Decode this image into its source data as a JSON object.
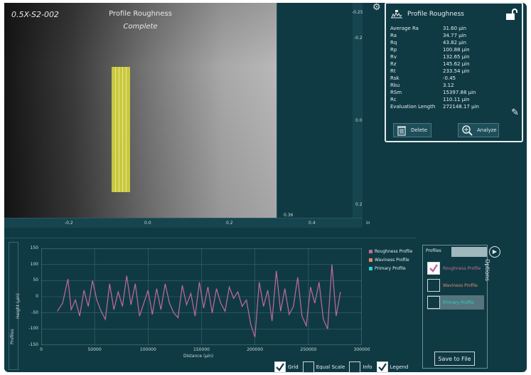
{
  "viewport": {
    "image_id": "0.5X-S2-002",
    "title": "Profile Roughness",
    "status": "Complete",
    "scale_right_ticks": [
      "-0.25",
      "-0.2",
      "0.0",
      "0.2"
    ],
    "scale_bottom_ticks": [
      "-0.2",
      "0.0",
      "0.2",
      "0.4"
    ],
    "scale_corner": "0.36",
    "scale_unit": "in"
  },
  "info_panel": {
    "title": "Profile Roughness",
    "metrics": [
      {
        "key": "Average Ra",
        "value": "31.60 µin"
      },
      {
        "key": "Ra",
        "value": "34.77 µin"
      },
      {
        "key": "Rq",
        "value": "43.82 µin"
      },
      {
        "key": "Rp",
        "value": "100.88 µin"
      },
      {
        "key": "Rv",
        "value": "132.65 µin"
      },
      {
        "key": "Rz",
        "value": "145.62 µin"
      },
      {
        "key": "Rt",
        "value": "233.54 µin"
      },
      {
        "key": "Rsk",
        "value": "-0.45"
      },
      {
        "key": "Rku",
        "value": "3.12"
      },
      {
        "key": "RSm",
        "value": "15397.88 µin"
      },
      {
        "key": "Rc",
        "value": "110.11 µin"
      },
      {
        "key": "Evaluation Length",
        "value": "272148.17 µin"
      }
    ],
    "delete_label": "Delete",
    "analyze_label": "Analyze"
  },
  "chart_data": {
    "type": "line",
    "xlabel": "Distance (µin)",
    "ylabel": "Height (µin)",
    "xlim": [
      0,
      300000
    ],
    "ylim": [
      -150,
      150
    ],
    "xticks": [
      "0",
      "50000",
      "100000",
      "150000",
      "200000",
      "250000",
      "300000"
    ],
    "yticks": [
      "150",
      "100",
      "50",
      "0",
      "-50",
      "-100",
      "-150"
    ],
    "grid": true,
    "legend": "right",
    "series": [
      {
        "name": "Roughness Profile",
        "color": "#c46aa0",
        "x": [
          15000,
          20000,
          25000,
          28000,
          32000,
          36000,
          40000,
          44000,
          48000,
          52000,
          56000,
          60000,
          64000,
          68000,
          72000,
          76000,
          80000,
          84000,
          88000,
          92000,
          96000,
          100000,
          104000,
          108000,
          112000,
          116000,
          120000,
          124000,
          128000,
          132000,
          136000,
          140000,
          144000,
          148000,
          152000,
          156000,
          160000,
          164000,
          168000,
          172000,
          176000,
          180000,
          184000,
          188000,
          192000,
          196000,
          200000,
          204000,
          208000,
          212000,
          216000,
          220000,
          224000,
          228000,
          232000,
          236000,
          240000,
          244000,
          248000,
          252000,
          256000,
          260000,
          264000,
          268000,
          272000,
          276000,
          280000
        ],
        "y": [
          -45,
          -20,
          55,
          -40,
          -10,
          -60,
          20,
          -30,
          50,
          -10,
          -45,
          -70,
          40,
          -40,
          15,
          -30,
          65,
          -25,
          40,
          -60,
          -20,
          20,
          -55,
          25,
          -40,
          40,
          -20,
          -50,
          -65,
          35,
          -25,
          10,
          -60,
          45,
          -35,
          30,
          -50,
          25,
          -20,
          -45,
          30,
          -5,
          15,
          -30,
          -10,
          -85,
          -125,
          45,
          -30,
          20,
          -75,
          80,
          -45,
          25,
          -55,
          -30,
          60,
          -60,
          -90,
          30,
          -20,
          45,
          -70,
          -100,
          100,
          -60,
          15
        ]
      },
      {
        "name": "Waviness Profile",
        "color": "#e58b6a",
        "x": [],
        "y": []
      },
      {
        "name": "Primary Profile",
        "color": "#28d4c8",
        "x": [],
        "y": []
      }
    ]
  },
  "options_panel": {
    "tab_label": "Profiles",
    "items": [
      {
        "label": "Roughness Profile",
        "checked": true,
        "color": "#c46aa0"
      },
      {
        "label": "Waviness Profile",
        "checked": false,
        "color": "#e58b6a"
      },
      {
        "label": "Primary Profile",
        "checked": false,
        "color": "#28d4c8"
      }
    ],
    "save_label": "Save to File",
    "options_label": "Options"
  },
  "bottom_checks": [
    {
      "label": "Grid",
      "checked": true
    },
    {
      "label": "Equal Scale",
      "checked": false
    },
    {
      "label": "Info",
      "checked": false
    },
    {
      "label": "Legend",
      "checked": true
    }
  ],
  "side_tab_label": "Profiles"
}
